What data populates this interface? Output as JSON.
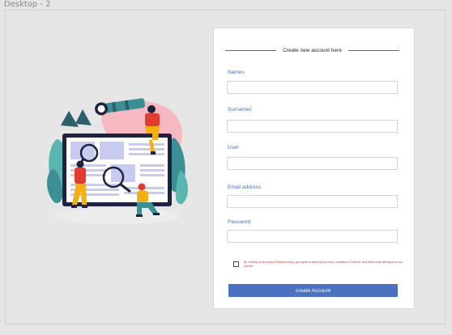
{
  "frame": {
    "label": "Desktop - 2"
  },
  "form": {
    "title": "Create new account here",
    "fields": [
      {
        "label": "Names",
        "value": "",
        "placeholder": ""
      },
      {
        "label": "Surnames",
        "value": "",
        "placeholder": ""
      },
      {
        "label": "User",
        "value": "",
        "placeholder": ""
      },
      {
        "label": "Email address",
        "value": "",
        "placeholder": ""
      },
      {
        "label": "Password",
        "value": "",
        "placeholder": ""
      }
    ],
    "terms_text": "By creating an account at Research Easy, you agree to abide by our terms, conditions of service, and honor code and agree to our policies",
    "terms_checked": false,
    "submit_label": "create Account",
    "accent_color": "#4c71c1",
    "label_color": "#4a6fbf"
  },
  "illustration": {
    "icon": "research-team-illustration"
  }
}
